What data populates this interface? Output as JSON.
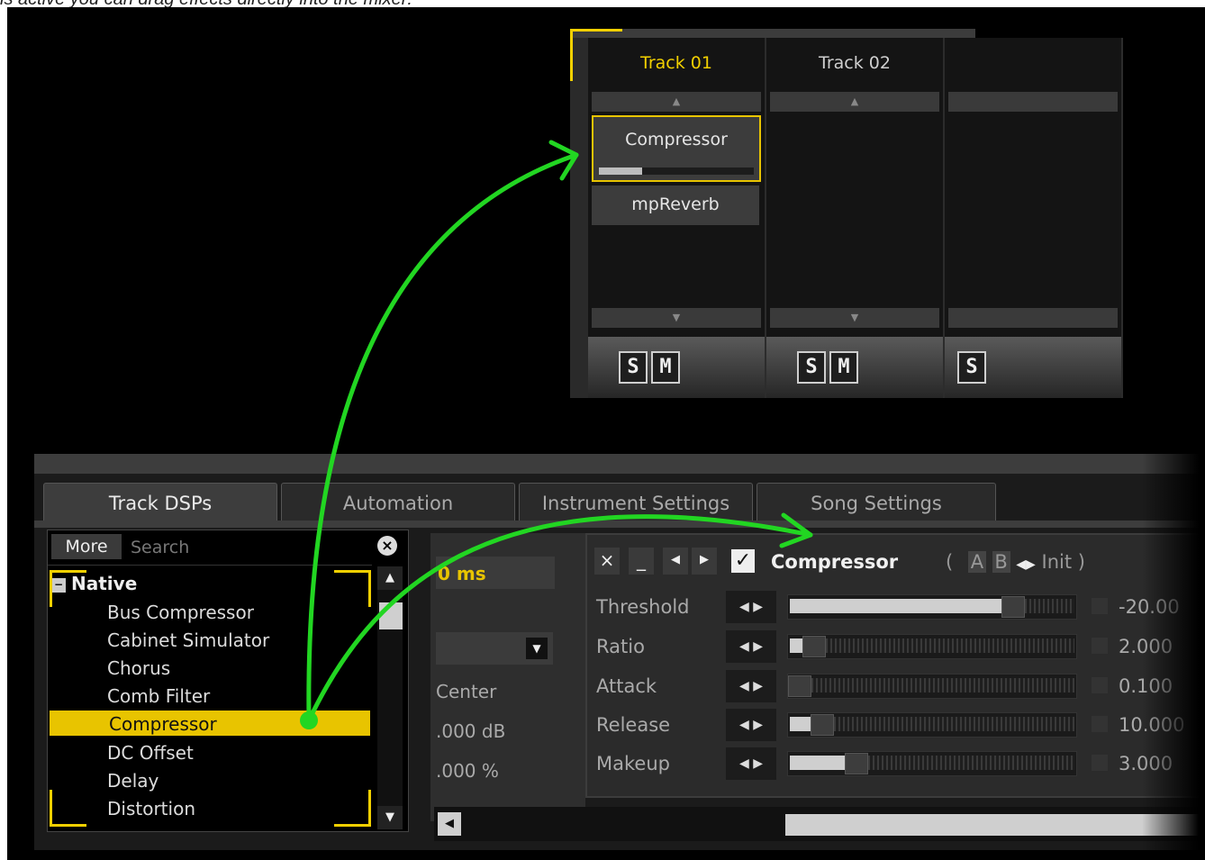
{
  "caption": "is active you can drag effects directly into the mixer:",
  "mixer": {
    "tracks": [
      {
        "name": "Track 01",
        "active": true,
        "dsps": [
          "Compressor",
          "mpReverb"
        ],
        "solo": "S",
        "mute": "M"
      },
      {
        "name": "Track 02",
        "active": false,
        "dsps": [],
        "solo": "S",
        "mute": "M"
      },
      {
        "solo": "S"
      }
    ]
  },
  "tabs": [
    "Track DSPs",
    "Automation",
    "Instrument Settings",
    "Song Settings"
  ],
  "browser": {
    "more_label": "More",
    "search_placeholder": "Search",
    "category": "Native",
    "items": [
      "Bus Compressor",
      "Cabinet Simulator",
      "Chorus",
      "Comb Filter",
      "Compressor",
      "DC Offset",
      "Delay",
      "Distortion"
    ],
    "selected": "Compressor"
  },
  "middle": {
    "delay_value": "0 ms",
    "pan_label": "Center",
    "volume_value": ".000 dB",
    "width_value": ".000 %"
  },
  "effect": {
    "name": "Compressor",
    "preset_prefix": "(",
    "preset_a": "A",
    "preset_b": "B",
    "preset_name": "Init",
    "preset_suffix": ")",
    "params": [
      {
        "label": "Threshold",
        "value": "-20.00",
        "level": 0.75
      },
      {
        "label": "Ratio",
        "value": "2.000",
        "level": 0.05
      },
      {
        "label": "Attack",
        "value": "0.100",
        "level": 0.0
      },
      {
        "label": "Release",
        "value": "10.000",
        "level": 0.08
      },
      {
        "label": "Makeup",
        "value": "3.000",
        "level": 0.2
      }
    ]
  },
  "colors": {
    "accent": "#f2d000",
    "arrow": "#22d622",
    "selection": "#e8c400"
  }
}
